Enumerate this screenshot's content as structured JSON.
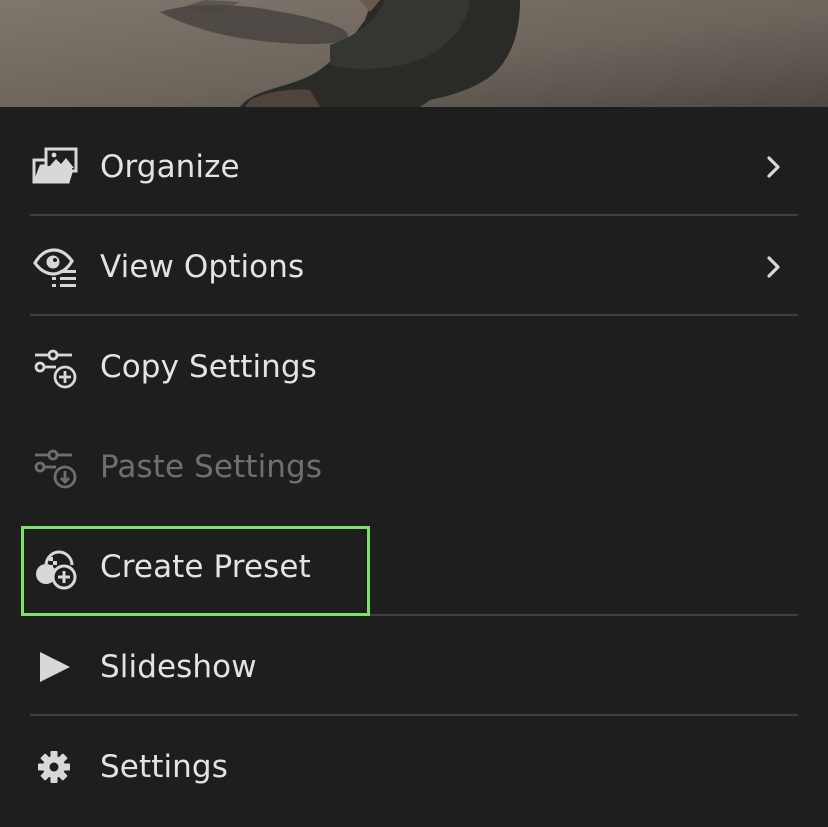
{
  "menu": {
    "items": [
      {
        "label": "Organize",
        "icon": "folder-photo-icon",
        "has_submenu": true,
        "enabled": true
      },
      {
        "label": "View Options",
        "icon": "eye-list-icon",
        "has_submenu": true,
        "enabled": true
      },
      {
        "label": "Copy Settings",
        "icon": "sliders-plus-icon",
        "has_submenu": false,
        "enabled": true
      },
      {
        "label": "Paste Settings",
        "icon": "sliders-download-icon",
        "has_submenu": false,
        "enabled": false
      },
      {
        "label": "Create Preset",
        "icon": "preset-plus-icon",
        "has_submenu": false,
        "enabled": true,
        "highlighted": true
      },
      {
        "label": "Slideshow",
        "icon": "play-icon",
        "has_submenu": false,
        "enabled": true
      },
      {
        "label": "Settings",
        "icon": "gear-icon",
        "has_submenu": false,
        "enabled": true
      }
    ]
  },
  "colors": {
    "background": "#1e1e1e",
    "text": "#e3e3e3",
    "disabled_text": "#6f6f6f",
    "divider": "#3e3e3e",
    "highlight": "#7de06a"
  }
}
